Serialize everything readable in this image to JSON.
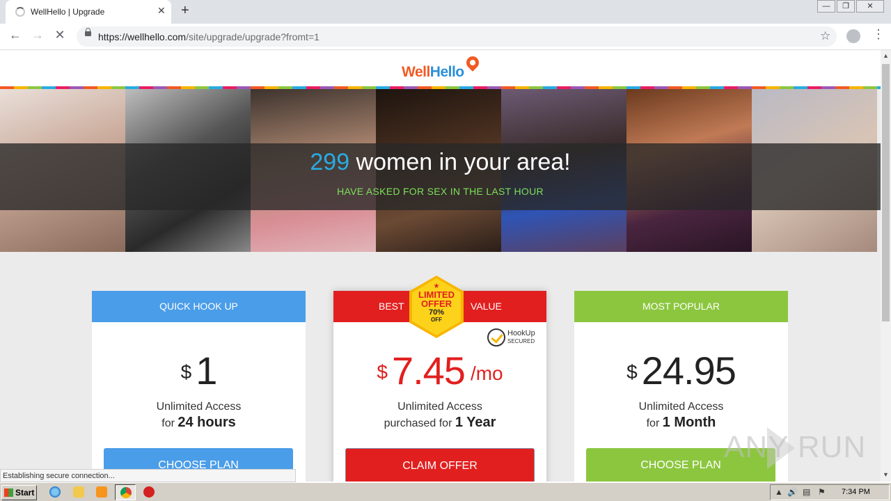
{
  "browser": {
    "tab_title": "WellHello | Upgrade",
    "tab_close": "✕",
    "new_tab": "+",
    "url_host": "https://wellhello.com",
    "url_path": "/site/upgrade/upgrade?fromt=1",
    "window_buttons": {
      "minimize": "—",
      "maximize": "❐",
      "close": "✕"
    }
  },
  "site": {
    "logo_part1": "Well",
    "logo_part2": "Hello"
  },
  "hero": {
    "count": "299",
    "headline": " women in your area!",
    "subline": "HAVE ASKED FOR SEX IN THE LAST HOUR"
  },
  "plans": {
    "left": {
      "header": "QUICK HOOK UP",
      "currency": "$",
      "amount": "1",
      "line1": "Unlimited Access",
      "line2_prefix": "for ",
      "line2_bold": "24 hours",
      "button": "CHOOSE PLAN"
    },
    "middle": {
      "header_left": "BEST",
      "header_right": "VALUE",
      "currency": "$",
      "amount": "7.45",
      "per": "/mo",
      "line1": "Unlimited Access",
      "line2_prefix": "purchased for ",
      "line2_bold": "1 Year",
      "button": "CLAIM OFFER",
      "badge": {
        "star": "★",
        "line1": "LIMITED",
        "line2": "OFFER",
        "line3": "70%",
        "line4": "OFF"
      },
      "secured": {
        "line1": "HookUp",
        "line2": "SECURED"
      }
    },
    "right": {
      "header": "MOST POPULAR",
      "currency": "$",
      "amount": "24.95",
      "line1": "Unlimited Access",
      "line2_prefix": "for ",
      "line2_bold": "1 Month",
      "button": "CHOOSE PLAN"
    }
  },
  "watermark": "ANY   RUN",
  "status_text": "Establishing secure connection...",
  "taskbar": {
    "start": "Start",
    "clock": "7:34 PM"
  },
  "colors": {
    "blue": "#4a9de8",
    "red": "#e21f1f",
    "green": "#8cc63f",
    "accent_count": "#29abe2",
    "subline": "#7de05b"
  }
}
